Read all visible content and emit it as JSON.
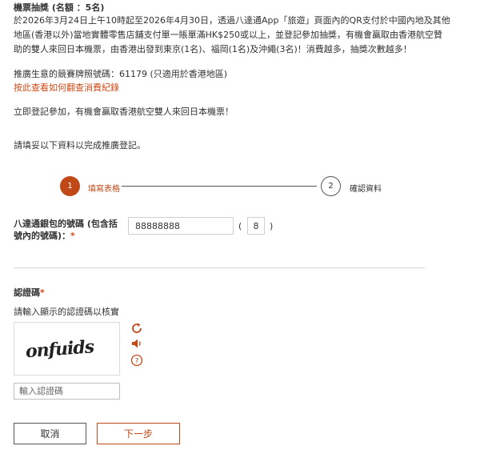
{
  "intro": {
    "heading": "機票抽獎 (名額 ：5名)",
    "lines": [
      "於2026年3月24日上午10時起至2026年4月30日，透過八達通App「旅遊」頁面內的QR支付於中國內地及其他",
      "地區(香港以外)當地實體零售店舖支付單一賬單滿HK$250或以上，並登記參加抽獎，有機會贏取由香港航空贊",
      "助的雙人來回日本機票，由香港出發到東京(1名)、福岡(1名)及沖繩(3名)！消費越多，抽獎次數越多！"
    ],
    "licence": "推廣生意的競賽牌照號碼：61179 (只適用於香港地區)",
    "how_link": "按此查看如何翻查消費紀錄",
    "join": "立即登記參加，有機會贏取香港航空雙人來回日本機票！",
    "fill_prompt": "請填妥以下資料以完成推廣登記。"
  },
  "stepper": {
    "step1_number": "1",
    "step1_label": "填寫表格",
    "step2_number": "2",
    "step2_label": "確認資料"
  },
  "form": {
    "octopus_label": "八達通銀包的號碼 (包含括號內的號碼)：",
    "required_mark": "*",
    "octopus_value": "88888888",
    "paren_open": "(",
    "check_digit": "8",
    "paren_close": ")"
  },
  "captcha": {
    "title": "認證碼",
    "required_mark": "*",
    "instruction": "請輸入顯示的認證碼以核實",
    "image_text": "onfuids",
    "input_placeholder": "輸入認證碼",
    "help_glyph": "?"
  },
  "buttons": {
    "cancel": "取消",
    "next": "下一步"
  },
  "colors": {
    "accent": "#c14817",
    "link": "#d04a17"
  }
}
